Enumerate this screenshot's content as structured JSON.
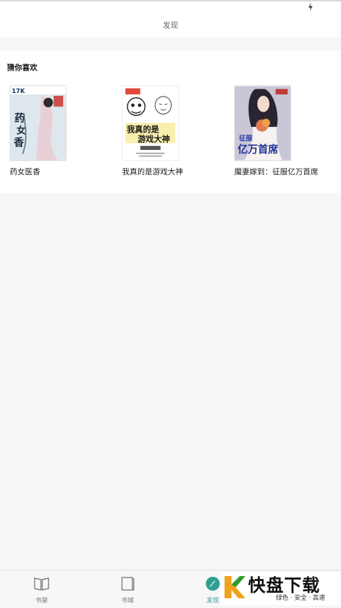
{
  "header": {
    "title": "发现"
  },
  "section": {
    "title": "猜你喜欢",
    "books": [
      {
        "title": "药女医香",
        "cover_text_top": "17K",
        "cover_text_main": "药女医香"
      },
      {
        "title": "我真的是游戏大神",
        "cover_text_main": "我真的是游戏大神"
      },
      {
        "title": "魔妻嫁到：征服亿万首席",
        "cover_text_main": "亿万首席",
        "cover_text_top": "征服"
      }
    ]
  },
  "tabs": [
    {
      "label": "书架",
      "icon": "open-book-icon"
    },
    {
      "label": "书城",
      "icon": "bookstore-icon"
    },
    {
      "label": "发现",
      "icon": "discover-compass-icon",
      "active": true
    }
  ],
  "watermark": {
    "main": "快盘下载",
    "sub": "绿色 · 安全 · 高速"
  },
  "colors": {
    "accent": "#2f9f92",
    "background": "#f6f6f6"
  }
}
